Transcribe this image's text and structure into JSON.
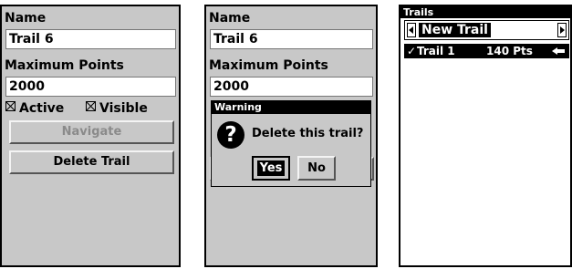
{
  "screen1": {
    "name_label": "Name",
    "name_value": "Trail 6",
    "max_points_label": "Maximum Points",
    "max_points_value": "2000",
    "active_label": "Active",
    "visible_label": "Visible",
    "navigate_label": "Navigate",
    "delete_label": "Delete Trail"
  },
  "screen2": {
    "name_label": "Name",
    "name_value": "Trail 6",
    "max_points_label": "Maximum Points",
    "max_points_value": "2000",
    "dialog": {
      "title": "Warning",
      "icon": "question-icon",
      "icon_glyph": "?",
      "message": "Delete this trail?",
      "yes_label": "Yes",
      "no_label": "No"
    }
  },
  "screen3": {
    "title": "Trails",
    "selector_value": "New Trail",
    "trails": [
      {
        "check": "✓",
        "name": "Trail 1",
        "points": "140 Pts"
      }
    ]
  },
  "colors": {
    "background": "#c8c8c8",
    "field": "#ffffff",
    "highlight": "#000000",
    "text_on_highlight": "#ffffff"
  }
}
